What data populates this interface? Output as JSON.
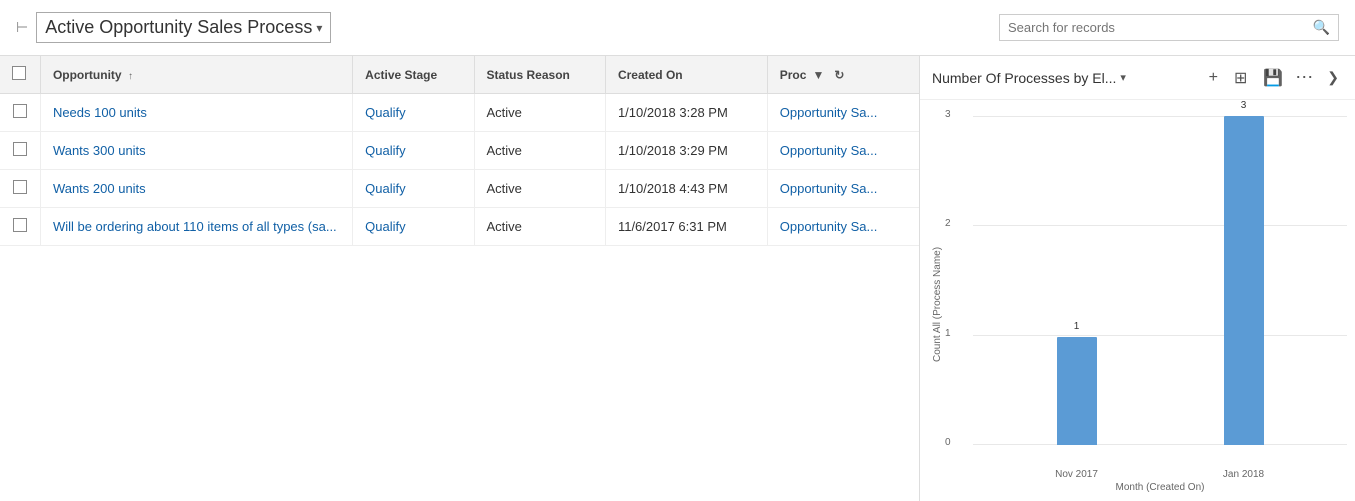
{
  "header": {
    "title": "Active Opportunity Sales Process",
    "dropdown_icon": "▾",
    "pin_icon": "⊢",
    "search_placeholder": "Search for records",
    "search_icon": "🔍"
  },
  "table": {
    "columns": [
      {
        "key": "check",
        "label": ""
      },
      {
        "key": "opportunity",
        "label": "Opportunity",
        "sort": "↑"
      },
      {
        "key": "active_stage",
        "label": "Active Stage"
      },
      {
        "key": "status_reason",
        "label": "Status Reason"
      },
      {
        "key": "created_on",
        "label": "Created On"
      },
      {
        "key": "process",
        "label": "Proc"
      }
    ],
    "rows": [
      {
        "opportunity": "Needs 100 units",
        "active_stage": "Qualify",
        "status_reason": "Active",
        "created_on": "1/10/2018 3:28 PM",
        "process": "Opportunity Sa..."
      },
      {
        "opportunity": "Wants 300 units",
        "active_stage": "Qualify",
        "status_reason": "Active",
        "created_on": "1/10/2018 3:29 PM",
        "process": "Opportunity Sa..."
      },
      {
        "opportunity": "Wants 200 units",
        "active_stage": "Qualify",
        "status_reason": "Active",
        "created_on": "1/10/2018 4:43 PM",
        "process": "Opportunity Sa..."
      },
      {
        "opportunity": "Will be ordering about 110 items of all types (sa...",
        "active_stage": "Qualify",
        "status_reason": "Active",
        "created_on": "11/6/2017 6:31 PM",
        "process": "Opportunity Sa..."
      }
    ]
  },
  "chart": {
    "title": "Number Of Processes by El...",
    "dropdown_icon": "▾",
    "y_axis_label": "Count All (Process Name)",
    "x_axis_label": "Month (Created On)",
    "bars": [
      {
        "label": "Nov 2017",
        "value": 1,
        "height_pct": 33
      },
      {
        "label": "Jan 2018",
        "value": 3,
        "height_pct": 100
      }
    ],
    "y_ticks": [
      {
        "value": "3",
        "pct": 0
      },
      {
        "value": "2",
        "pct": 33
      },
      {
        "value": "1",
        "pct": 67
      },
      {
        "value": "0",
        "pct": 100
      }
    ],
    "actions": {
      "add": "+",
      "layout": "⊞",
      "save": "💾",
      "more": "...",
      "expand": "❯"
    }
  }
}
